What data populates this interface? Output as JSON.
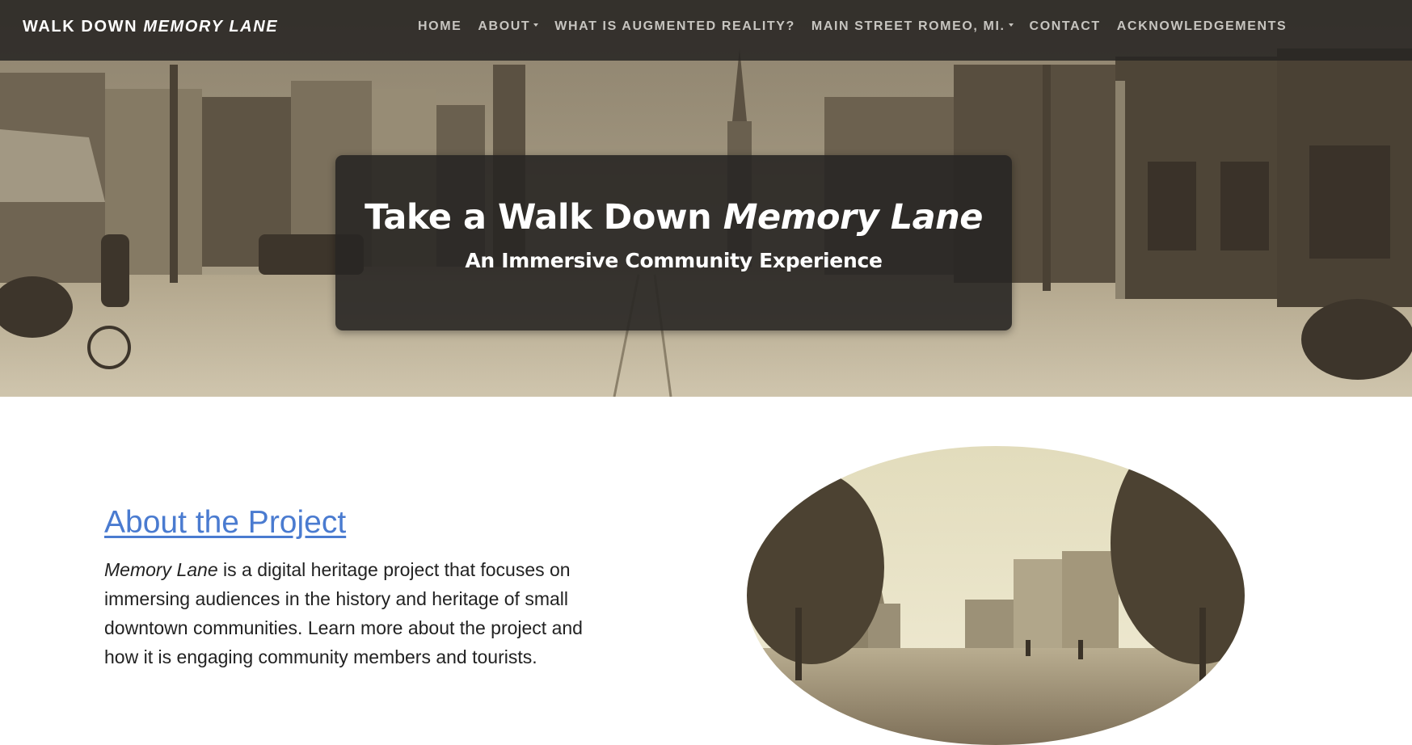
{
  "navbar": {
    "brand_prefix": "WALK DOWN ",
    "brand_emphasis": "MEMORY LANE",
    "items": [
      {
        "label": "HOME",
        "dropdown": false
      },
      {
        "label": "ABOUT",
        "dropdown": true
      },
      {
        "label": "WHAT IS AUGMENTED REALITY?",
        "dropdown": false
      },
      {
        "label": "MAIN STREET ROMEO, MI.",
        "dropdown": true
      },
      {
        "label": "CONTACT",
        "dropdown": false
      },
      {
        "label": "ACKNOWLEDGEMENTS",
        "dropdown": false
      }
    ]
  },
  "hero": {
    "title_prefix": "Take a Walk Down ",
    "title_emphasis": "Memory Lane",
    "subtitle": "An Immersive Community Experience"
  },
  "about": {
    "heading": "About the Project",
    "body_emphasis": "Memory Lane",
    "body_rest": " is a digital heritage project that focuses on immersing audiences in the history and heritage of small downtown communities. Learn more about the project and how it is engaging community members and tourists."
  },
  "colors": {
    "nav_bg": "#282623",
    "link": "#4a7bd0",
    "panel_bg": "#282624",
    "sepia_light": "#e8e2c8",
    "sepia_dark": "#6e6454"
  },
  "icons": [
    "caret-down-icon"
  ]
}
